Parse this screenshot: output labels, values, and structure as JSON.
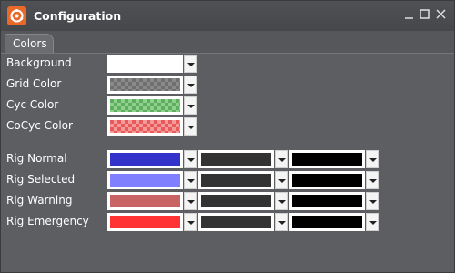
{
  "window": {
    "title": "Configuration",
    "icon": "app-logo-icon"
  },
  "tabs": [
    {
      "label": "Colors",
      "active": true
    }
  ],
  "basic_colors": [
    {
      "label": "Background",
      "color": "#ffffff"
    },
    {
      "label": "Grid Color",
      "color": "checker-gray"
    },
    {
      "label": "Cyc Color",
      "color": "checker-green"
    },
    {
      "label": "CoCyc Color",
      "color": "checker-red"
    }
  ],
  "rig_colors": [
    {
      "label": "Rig Normal",
      "colors": [
        "#3333cc",
        "#333333",
        "#000000"
      ]
    },
    {
      "label": "Rig Selected",
      "colors": [
        "#8080ff",
        "#333333",
        "#000000"
      ]
    },
    {
      "label": "Rig Warning",
      "colors": [
        "#c86464",
        "#333333",
        "#000000"
      ]
    },
    {
      "label": "Rig Emergency",
      "colors": [
        "#ff3333",
        "#333333",
        "#000000"
      ]
    }
  ]
}
